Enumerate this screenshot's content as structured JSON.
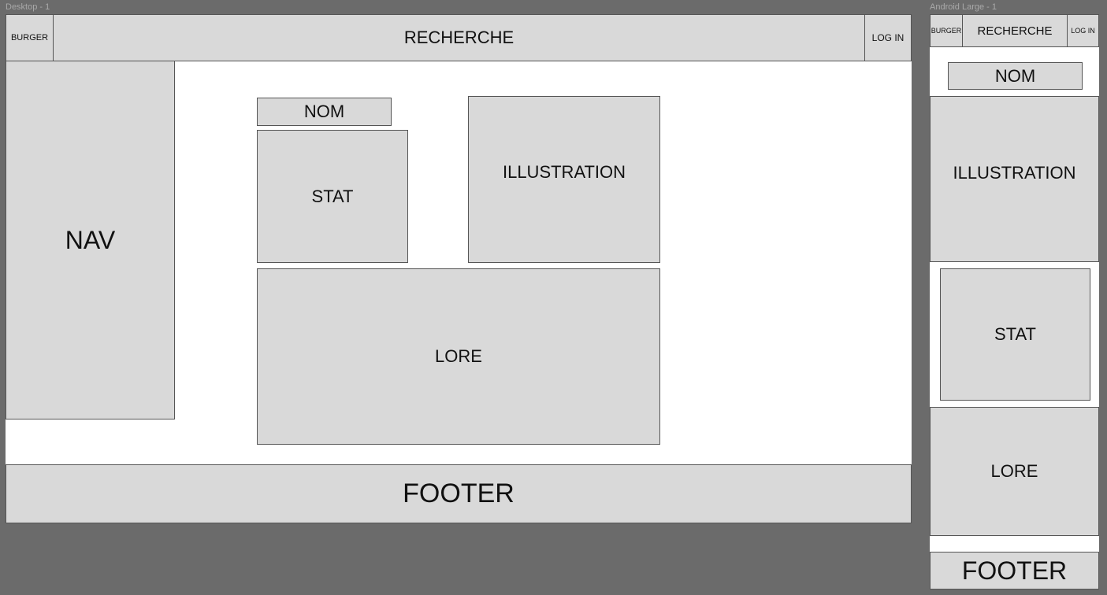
{
  "desktop": {
    "frame_label": "Desktop - 1",
    "burger": "BURGER",
    "search": "RECHERCHE",
    "login": "LOG IN",
    "nav": "NAV",
    "name": "NOM",
    "stat": "STAT",
    "illustration": "ILLUSTRATION",
    "lore": "LORE",
    "footer": "FOOTER"
  },
  "mobile": {
    "frame_label": "Android Large - 1",
    "burger": "BURGER",
    "search": "RECHERCHE",
    "login": "LOG IN",
    "name": "NOM",
    "illustration": "ILLUSTRATION",
    "stat": "STAT",
    "lore": "LORE",
    "footer": "FOOTER"
  }
}
